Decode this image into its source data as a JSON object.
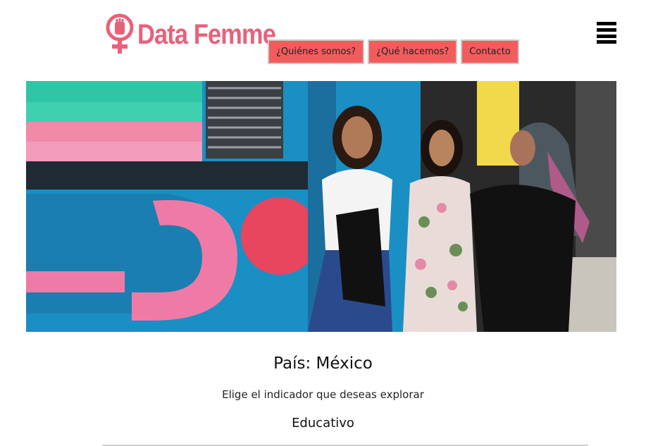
{
  "brand": {
    "name": "Data Femme",
    "color": "#e8617a"
  },
  "nav": {
    "items": [
      {
        "label": "¿Quiénes somos?"
      },
      {
        "label": "¿Qué hacemos?"
      },
      {
        "label": "Contacto"
      }
    ],
    "button_color": "#f25c5c"
  },
  "menu": {
    "icon": "hamburger-menu-icon"
  },
  "hero": {
    "image": "three women walking past colorful graffiti wall"
  },
  "content": {
    "country_label": "País: México",
    "subtitle": "Elige el indicador que deseas explorar",
    "category": "Educativo"
  }
}
